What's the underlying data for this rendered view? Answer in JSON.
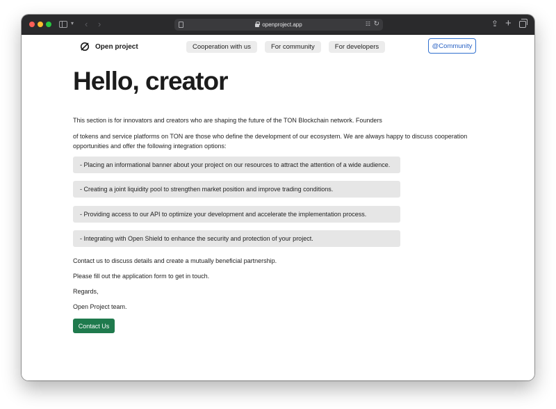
{
  "browser": {
    "url": "openproject.app",
    "colors": {
      "titlebar": "#2a2a2c",
      "close": "#fe5f57",
      "minimize": "#febc2e",
      "zoom": "#28c840"
    },
    "icons": [
      "sidebar-icon",
      "chevron-down-icon",
      "back-icon",
      "forward-icon",
      "reader-icon",
      "lock-icon",
      "translate-icon",
      "reload-icon",
      "share-icon",
      "new-tab-icon",
      "tabs-overview-icon"
    ]
  },
  "header": {
    "logo_text": "Open project",
    "logo_icon": "slashed-circle-icon",
    "nav": [
      {
        "label": "Cooperation with us"
      },
      {
        "label": "For community"
      },
      {
        "label": "For developers"
      }
    ],
    "community_button": "@Community",
    "accent_color": "#2a63c4"
  },
  "main": {
    "title": "Hello, creator",
    "intro_1": "This section is for innovators and creators who are shaping the future of the TON Blockchain network. Founders",
    "intro_2": "of tokens and service platforms on TON are those who define the development of our ecosystem. We are always happy to discuss cooperation opportunities and offer the following integration options:",
    "options": [
      "- Placing an informational banner about your project on our resources to attract the attention of a wide audience.",
      "- Creating a joint liquidity pool to strengthen market position and improve trading conditions.",
      "- Providing access to our API to optimize your development and accelerate the implementation process.",
      "- Integrating with Open Shield to enhance the security and protection of your project."
    ],
    "contact_text": "Contact us to discuss details and create a mutually beneficial partnership.",
    "form_text": "Please fill out the application form to get in touch.",
    "regards": "Regards,",
    "signature": "Open Project team.",
    "contact_button": "Contact Us",
    "button_color": "#1f7a4d"
  }
}
